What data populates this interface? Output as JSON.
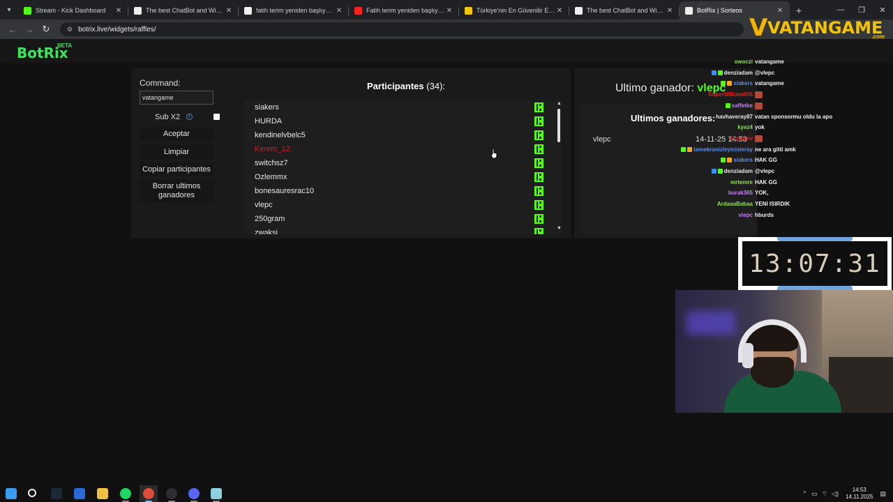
{
  "browser": {
    "tabs": [
      {
        "title": "Stream - Kick Dashboard",
        "favicon": "kick-icon",
        "active": false
      },
      {
        "title": "The best ChatBot and Widgets",
        "favicon": "botrix-icon",
        "active": false
      },
      {
        "title": "fatih terim yeniden başlıyoruz",
        "favicon": "google-icon",
        "active": false
      },
      {
        "title": "Fatih terim yeniden başlıyoruz",
        "favicon": "youtube-icon",
        "active": false
      },
      {
        "title": "Türkiye'nin En Güvenilir E-Pin s",
        "favicon": "vatangame-icon",
        "active": false
      },
      {
        "title": "The best ChatBot and Widgets",
        "favicon": "botrix-icon",
        "active": false
      },
      {
        "title": "BotRix | Sorteos",
        "favicon": "botrix-icon",
        "active": true
      }
    ],
    "url": "botrix.live/widgets/raffles/"
  },
  "overlay_logo": {
    "brand": "VATANGAME",
    "suffix": ".com"
  },
  "app": {
    "logo": "BotRix",
    "badge": "BETA"
  },
  "raffle": {
    "command_label": "Command:",
    "command_value": "vatangame",
    "sub_label": "Sub X2",
    "sub_checked": false,
    "buttons": {
      "accept": "Aceptar",
      "clear": "Limpiar",
      "copy": "Copiar participantes",
      "delete_winners": "Borrar ultimos ganadores"
    },
    "participants_title": "Participantes",
    "participants_count": "(34):",
    "participants": [
      {
        "name": "siakers",
        "highlight": false
      },
      {
        "name": "HURDA",
        "highlight": false
      },
      {
        "name": "kendinelvbelc5",
        "highlight": false
      },
      {
        "name": "Kerem_12",
        "highlight": true
      },
      {
        "name": "switchsz7",
        "highlight": false
      },
      {
        "name": "Ozlemmx",
        "highlight": false
      },
      {
        "name": "bonesauresrac10",
        "highlight": false
      },
      {
        "name": "vlepc",
        "highlight": false
      },
      {
        "name": "250gram",
        "highlight": false
      },
      {
        "name": "zwaksi",
        "highlight": false
      }
    ],
    "last_winner_label": "Ultimo ganador:",
    "last_winner": "vlepc",
    "winners_title": "Ultimos ganadores:",
    "winners": [
      {
        "name": "vlepc",
        "date": "14-11-25 14:53"
      }
    ]
  },
  "chat": [
    {
      "user": "swoczi",
      "color": "#8fe04a",
      "msg": "vatangame",
      "badges": []
    },
    {
      "user": "denziadam",
      "color": "#e8e8e8",
      "msg": "@vlepc",
      "badges": [
        "#3a8ff0",
        "#53fc18"
      ]
    },
    {
      "user": "siakers",
      "color": "#5a8ff0",
      "msg": "vatangame",
      "badges": [
        "#53fc18",
        "#f5a623"
      ]
    },
    {
      "user": "SuperWilliam006",
      "color": "#e02020",
      "msg": "",
      "badges": [],
      "emote": true
    },
    {
      "user": "saffetke",
      "color": "#c080f0",
      "msg": "",
      "badges": [
        "#53fc18"
      ],
      "emote": true
    },
    {
      "user": "havhaveray87",
      "color": "#e8e8e8",
      "msg": "vatan sponsormu oldu la apo",
      "badges": []
    },
    {
      "user": "kyez4",
      "color": "#8fe04a",
      "msg": "yok",
      "badges": []
    },
    {
      "user": "Fizzatov",
      "color": "#e02020",
      "msg": "",
      "badges": [],
      "emote": true
    },
    {
      "user": "tamekranizleyicisieray",
      "color": "#5a8ff0",
      "msg": "ne ara gitti amk",
      "badges": [
        "#53fc18",
        "#f5a623"
      ]
    },
    {
      "user": "siakers",
      "color": "#5a8ff0",
      "msg": "HAK GG",
      "badges": [
        "#53fc18",
        "#f5a623"
      ]
    },
    {
      "user": "denziadam",
      "color": "#e8e8e8",
      "msg": "@vlepc",
      "badges": [
        "#3a8ff0",
        "#53fc18"
      ]
    },
    {
      "user": "mrtemre",
      "color": "#8fe04a",
      "msg": "HAK GG",
      "badges": []
    },
    {
      "user": "burak365",
      "color": "#c080f0",
      "msg": "YOK,",
      "badges": []
    },
    {
      "user": "ArdaaaBabaa",
      "color": "#8fe04a",
      "msg": "YENI ISIRDIK",
      "badges": []
    },
    {
      "user": "vlepc",
      "color": "#c080f0",
      "msg": "hburds",
      "badges": []
    }
  ],
  "timer": "13:07:31",
  "taskbar": {
    "time": "14:53",
    "date": "14.11.2025",
    "apps": [
      "windows-icon",
      "search-icon",
      "steam-icon",
      "store-icon",
      "files-icon",
      "spotify-icon",
      "chrome-icon",
      "obs-icon",
      "discord-icon",
      "app-icon"
    ]
  }
}
